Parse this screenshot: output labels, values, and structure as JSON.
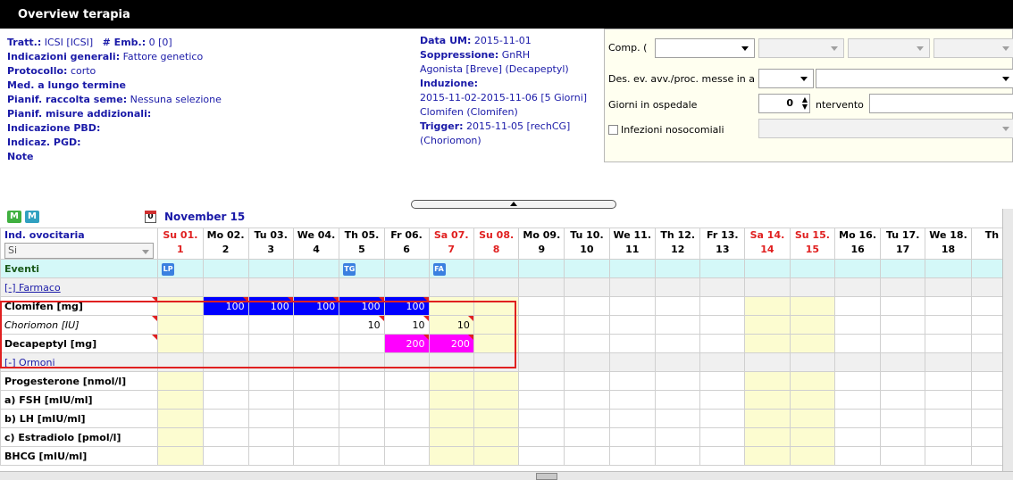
{
  "window": {
    "title": "Overview terapia"
  },
  "info_left": {
    "tratt_label": "Tratt.:",
    "tratt_value": "ICSI   [ICSI]",
    "emb_label": "# Emb.:",
    "emb_value": "0   [0]",
    "indicazioni_label": "Indicazioni generali:",
    "indicazioni_value": "Fattore genetico",
    "protocollo_label": "Protocollo:",
    "protocollo_value": "corto",
    "med_label": "Med. a lungo termine",
    "pianif_seme_label": "Pianif. raccolta seme:",
    "pianif_seme_value": "Nessuna selezione",
    "pianif_misure_label": "Pianif. misure addizionali:",
    "pbd_label": "Indicazione PBD:",
    "pgd_label": "Indicaz. PGD:",
    "note_label": "Note"
  },
  "info_mid": {
    "data_um_label": "Data UM:",
    "data_um_value": "2015-11-01",
    "soppressione_label": "Soppressione:",
    "soppressione_value": "GnRH",
    "soppressione_line2": "Agonista [Breve] (Decapeptyl)",
    "induzione_label": "Induzione:",
    "induzione_line1": "2015-11-02-2015-11-06 [5 Giorni]",
    "induzione_line2": "Clomifen (Clomifen)",
    "trigger_label": "Trigger:",
    "trigger_value": "2015-11-05 [rechCG]",
    "trigger_line2": "(Choriomon)"
  },
  "form": {
    "comp_label": "Comp. (",
    "des_label": "Des. ev. avv./proc. messe in a",
    "giorni_label": "Giorni in ospedale",
    "giorni_value": "0",
    "intervento_label": "ntervento",
    "infezioni_label": "Infezioni nosocomiali"
  },
  "grid": {
    "month": "November 15",
    "ind_label": "Ind. ovocitaria",
    "ind_select": "Si",
    "days": [
      {
        "d": "Su 01.",
        "n": "1",
        "we": true
      },
      {
        "d": "Mo 02.",
        "n": "2",
        "we": false
      },
      {
        "d": "Tu 03.",
        "n": "3",
        "we": false
      },
      {
        "d": "We 04.",
        "n": "4",
        "we": false
      },
      {
        "d": "Th 05.",
        "n": "5",
        "we": false
      },
      {
        "d": "Fr 06.",
        "n": "6",
        "we": false
      },
      {
        "d": "Sa 07.",
        "n": "7",
        "we": true
      },
      {
        "d": "Su 08.",
        "n": "8",
        "we": true
      },
      {
        "d": "Mo 09.",
        "n": "9",
        "we": false
      },
      {
        "d": "Tu 10.",
        "n": "10",
        "we": false
      },
      {
        "d": "We 11.",
        "n": "11",
        "we": false
      },
      {
        "d": "Th 12.",
        "n": "12",
        "we": false
      },
      {
        "d": "Fr 13.",
        "n": "13",
        "we": false
      },
      {
        "d": "Sa 14.",
        "n": "14",
        "we": true
      },
      {
        "d": "Su 15.",
        "n": "15",
        "we": true
      },
      {
        "d": "Mo 16.",
        "n": "16",
        "we": false
      },
      {
        "d": "Tu 17.",
        "n": "17",
        "we": false
      },
      {
        "d": "We 18.",
        "n": "18",
        "we": false
      },
      {
        "d": "Th",
        "n": "",
        "we": false
      }
    ],
    "eventi_label": "Eventi",
    "events": {
      "0": "LP",
      "4": "TG",
      "6": "FA"
    },
    "group_farmaco": "[-] Farmaco",
    "farmaco_rows": [
      {
        "label": "Clomifen [mg]",
        "italic": false,
        "values": {
          "1": "100",
          "2": "100",
          "3": "100",
          "4": "100",
          "5": "100"
        },
        "blue": [
          1,
          2,
          3,
          4,
          5
        ]
      },
      {
        "label": "Choriomon [IU]",
        "italic": true,
        "values": {
          "4": "10",
          "5": "10",
          "6": "10"
        },
        "blue": []
      },
      {
        "label": "Decapeptyl [mg]",
        "italic": false,
        "values": {
          "5": "200",
          "6": "200"
        },
        "mag": [
          5,
          6
        ]
      }
    ],
    "group_ormoni": "[-] Ormoni",
    "ormoni_rows": [
      "Progesterone  [nmol/l]",
      "a) FSH  [mIU/ml]",
      "b) LH  [mIU/ml]",
      "c) Estradiolo  [pmol/l]",
      "BHCG  [mIU/ml]"
    ]
  },
  "colors": {
    "title_bg": "#000000",
    "weekend": "#fcfcd0",
    "blue_cell": "#0000ff",
    "magenta_cell": "#ff00ff",
    "red": "#e02020",
    "events_bg": "#d4f8f8"
  }
}
